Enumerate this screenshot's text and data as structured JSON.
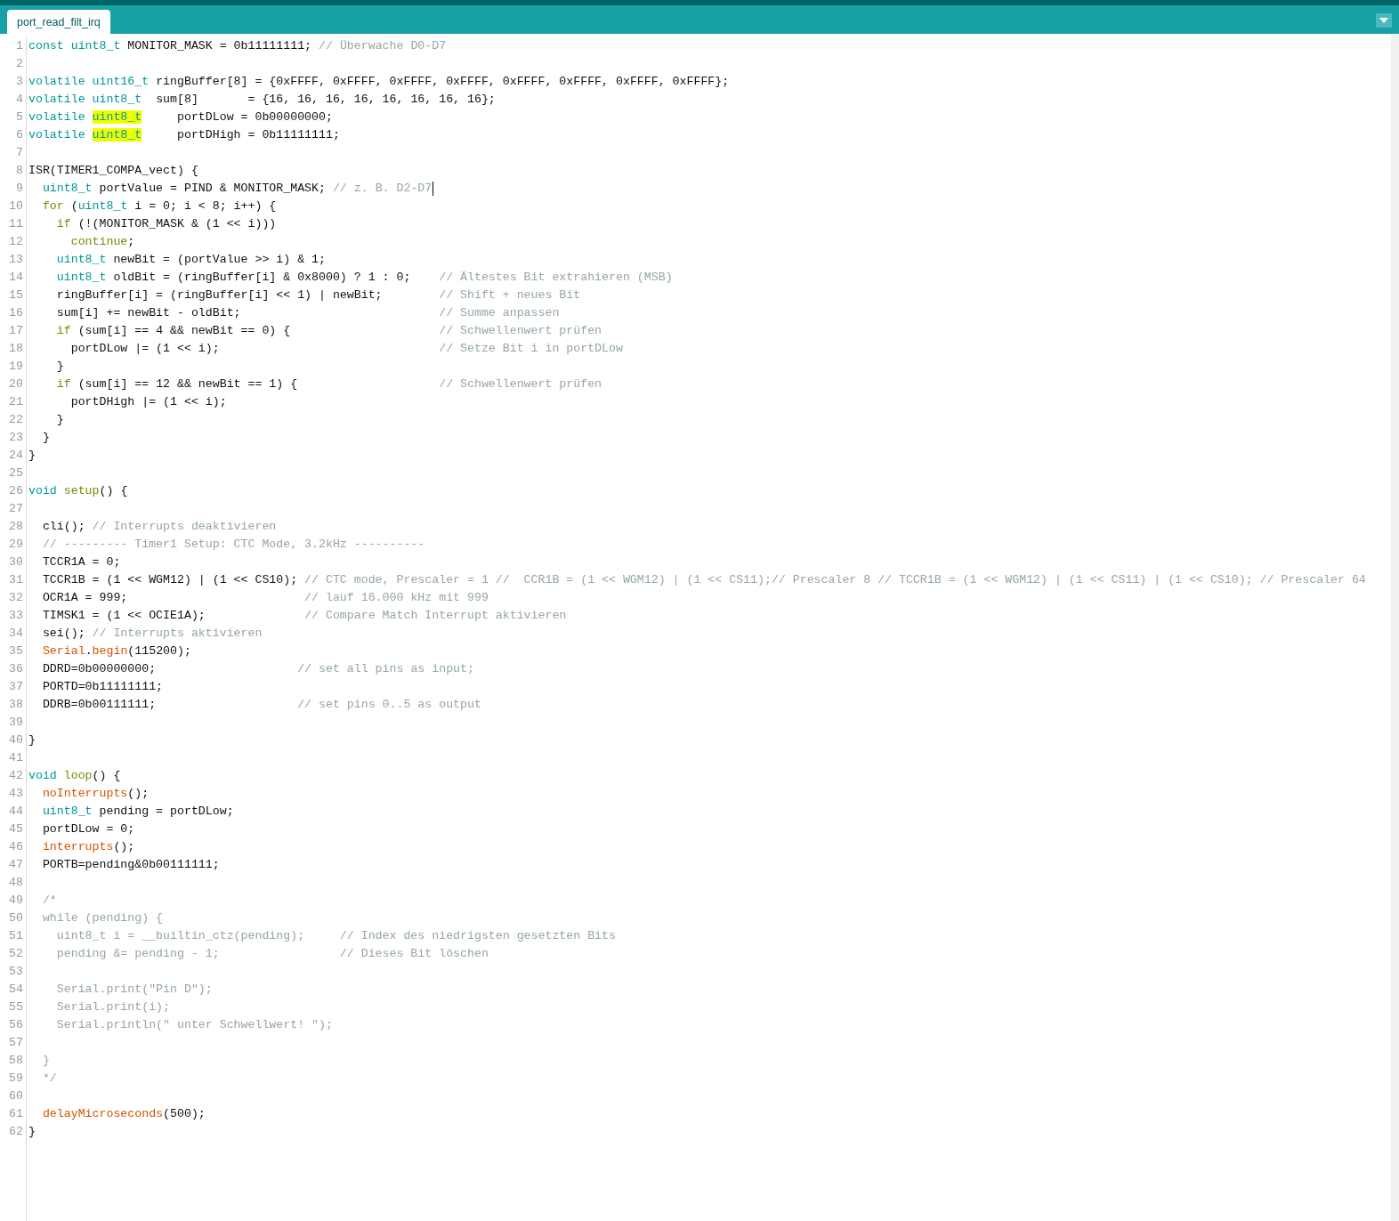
{
  "tabs": [
    {
      "label": "port_read_filt_irq",
      "selected": true
    }
  ],
  "editor": {
    "lines": [
      {
        "number": "1",
        "tokens": [
          {
            "kind": "type",
            "text": "const"
          },
          {
            "kind": "type",
            "text": " uint8_t"
          },
          {
            "kind": "plain",
            "text": " MONITOR_MASK = 0b11111111; "
          },
          {
            "kind": "comment",
            "text": "// Überwache D0-D7"
          }
        ]
      },
      {
        "number": "2"
      },
      {
        "number": "3",
        "tokens": [
          {
            "kind": "type",
            "text": "volatile uint16_t"
          },
          {
            "kind": "plain",
            "text": " ringBuffer[8] = {0xFFFF, 0xFFFF, 0xFFFF, 0xFFFF, 0xFFFF, 0xFFFF, 0xFFFF, 0xFFFF};"
          }
        ]
      },
      {
        "number": "4",
        "tokens": [
          {
            "kind": "type",
            "text": "volatile uint8_t"
          },
          {
            "kind": "plain",
            "text": "  sum[8]       = {16, 16, 16, 16, 16, 16, 16, 16};"
          }
        ]
      },
      {
        "number": "5",
        "tokens": [
          {
            "kind": "type",
            "text": "volatile "
          },
          {
            "kind": "type",
            "text": "uint8_t",
            "highlighted": true
          },
          {
            "kind": "plain",
            "text": "     portDLow = 0b00000000;"
          }
        ]
      },
      {
        "number": "6",
        "tokens": [
          {
            "kind": "type",
            "text": "volatile "
          },
          {
            "kind": "type",
            "text": "uint8_t",
            "highlighted": true
          },
          {
            "kind": "plain",
            "text": "     portDHigh = 0b11111111;"
          }
        ]
      },
      {
        "number": "7"
      },
      {
        "number": "8",
        "tokens": [
          {
            "kind": "plain",
            "text": "ISR(TIMER1_COMPA_vect) {"
          }
        ]
      },
      {
        "number": "9",
        "cursor": true,
        "tokens": [
          {
            "kind": "type",
            "text": "  uint8_t"
          },
          {
            "kind": "plain",
            "text": " portValue = PIND & MONITOR_MASK; "
          },
          {
            "kind": "comment",
            "text": "// z. B. D2-D7"
          }
        ]
      },
      {
        "number": "10",
        "tokens": [
          {
            "kind": "control",
            "text": "  for"
          },
          {
            "kind": "plain",
            "text": " ("
          },
          {
            "kind": "type",
            "text": "uint8_t"
          },
          {
            "kind": "plain",
            "text": " i = 0; i < 8; i++) {"
          }
        ]
      },
      {
        "number": "11",
        "tokens": [
          {
            "kind": "control",
            "text": "    if"
          },
          {
            "kind": "plain",
            "text": " (!(MONITOR_MASK & (1 << i)))"
          }
        ]
      },
      {
        "number": "12",
        "tokens": [
          {
            "kind": "control",
            "text": "      continue"
          },
          {
            "kind": "plain",
            "text": ";"
          }
        ]
      },
      {
        "number": "13",
        "tokens": [
          {
            "kind": "type",
            "text": "    uint8_t"
          },
          {
            "kind": "plain",
            "text": " newBit = (portValue >> i) & 1;"
          }
        ]
      },
      {
        "number": "14",
        "tokens": [
          {
            "kind": "type",
            "text": "    uint8_t"
          },
          {
            "kind": "plain",
            "text": " oldBit = (ringBuffer[i] & 0x8000) ? 1 : 0;    "
          },
          {
            "kind": "comment",
            "text": "// Ältestes Bit extrahieren (MSB)"
          }
        ]
      },
      {
        "number": "15",
        "tokens": [
          {
            "kind": "plain",
            "text": "    ringBuffer[i] = (ringBuffer[i] << 1) | newBit;        "
          },
          {
            "kind": "comment",
            "text": "// Shift + neues Bit"
          }
        ]
      },
      {
        "number": "16",
        "tokens": [
          {
            "kind": "plain",
            "text": "    sum[i] += newBit - oldBit;                            "
          },
          {
            "kind": "comment",
            "text": "// Summe anpassen"
          }
        ]
      },
      {
        "number": "17",
        "tokens": [
          {
            "kind": "control",
            "text": "    if"
          },
          {
            "kind": "plain",
            "text": " (sum[i] == 4 && newBit == 0) {                     "
          },
          {
            "kind": "comment",
            "text": "// Schwellenwert prüfen"
          }
        ]
      },
      {
        "number": "18",
        "tokens": [
          {
            "kind": "plain",
            "text": "      portDLow |= (1 << i);                               "
          },
          {
            "kind": "comment",
            "text": "// Setze Bit i in portDLow"
          }
        ]
      },
      {
        "number": "19",
        "tokens": [
          {
            "kind": "plain",
            "text": "    }"
          }
        ]
      },
      {
        "number": "20",
        "tokens": [
          {
            "kind": "control",
            "text": "    if"
          },
          {
            "kind": "plain",
            "text": " (sum[i] == 12 && newBit == 1) {                    "
          },
          {
            "kind": "comment",
            "text": "// Schwellenwert prüfen"
          }
        ]
      },
      {
        "number": "21",
        "tokens": [
          {
            "kind": "plain",
            "text": "      portDHigh |= (1 << i);"
          }
        ]
      },
      {
        "number": "22",
        "tokens": [
          {
            "kind": "plain",
            "text": "    }"
          }
        ]
      },
      {
        "number": "23",
        "tokens": [
          {
            "kind": "plain",
            "text": "  }"
          }
        ]
      },
      {
        "number": "24",
        "tokens": [
          {
            "kind": "plain",
            "text": "}"
          }
        ]
      },
      {
        "number": "25"
      },
      {
        "number": "26",
        "tokens": [
          {
            "kind": "type",
            "text": "void"
          },
          {
            "kind": "control",
            "text": " setup"
          },
          {
            "kind": "plain",
            "text": "() {"
          }
        ]
      },
      {
        "number": "27"
      },
      {
        "number": "28",
        "tokens": [
          {
            "kind": "plain",
            "text": "  cli(); "
          },
          {
            "kind": "comment",
            "text": "// Interrupts deaktivieren"
          }
        ]
      },
      {
        "number": "29",
        "tokens": [
          {
            "kind": "comment",
            "text": "  // --------- Timer1 Setup: CTC Mode, 3.2kHz ----------"
          }
        ]
      },
      {
        "number": "30",
        "tokens": [
          {
            "kind": "plain",
            "text": "  TCCR1A = 0;"
          }
        ]
      },
      {
        "number": "31",
        "tokens": [
          {
            "kind": "plain",
            "text": "  TCCR1B = (1 << WGM12) | (1 << CS10); "
          },
          {
            "kind": "comment",
            "text": "// CTC mode, Prescaler = 1 //  CCR1B = (1 << WGM12) | (1 << CS11);// Prescaler 8 // TCCR1B = (1 << WGM12) | (1 << CS11) | (1 << CS10); // Prescaler 64"
          }
        ]
      },
      {
        "number": "32",
        "tokens": [
          {
            "kind": "plain",
            "text": "  OCR1A = 999;                         "
          },
          {
            "kind": "comment",
            "text": "// lauf 16.000 kHz mit 999"
          }
        ]
      },
      {
        "number": "33",
        "tokens": [
          {
            "kind": "plain",
            "text": "  TIMSK1 = (1 << OCIE1A);              "
          },
          {
            "kind": "comment",
            "text": "// Compare Match Interrupt aktivieren"
          }
        ]
      },
      {
        "number": "34",
        "tokens": [
          {
            "kind": "plain",
            "text": "  sei(); "
          },
          {
            "kind": "comment",
            "text": "// Interrupts aktivieren"
          }
        ]
      },
      {
        "number": "35",
        "tokens": [
          {
            "kind": "function",
            "text": "  Serial"
          },
          {
            "kind": "plain",
            "text": "."
          },
          {
            "kind": "function",
            "text": "begin"
          },
          {
            "kind": "plain",
            "text": "(115200);"
          }
        ]
      },
      {
        "number": "36",
        "tokens": [
          {
            "kind": "plain",
            "text": "  DDRD=0b00000000;                    "
          },
          {
            "kind": "comment",
            "text": "// set all pins as input;"
          }
        ]
      },
      {
        "number": "37",
        "tokens": [
          {
            "kind": "plain",
            "text": "  PORTD=0b11111111;"
          }
        ]
      },
      {
        "number": "38",
        "tokens": [
          {
            "kind": "plain",
            "text": "  DDRB=0b00111111;                    "
          },
          {
            "kind": "comment",
            "text": "// set pins 0..5 as output"
          }
        ]
      },
      {
        "number": "39"
      },
      {
        "number": "40",
        "tokens": [
          {
            "kind": "plain",
            "text": "}"
          }
        ]
      },
      {
        "number": "41"
      },
      {
        "number": "42",
        "tokens": [
          {
            "kind": "type",
            "text": "void"
          },
          {
            "kind": "control",
            "text": " loop"
          },
          {
            "kind": "plain",
            "text": "() {"
          }
        ]
      },
      {
        "number": "43",
        "tokens": [
          {
            "kind": "function",
            "text": "  noInterrupts"
          },
          {
            "kind": "plain",
            "text": "();"
          }
        ]
      },
      {
        "number": "44",
        "tokens": [
          {
            "kind": "type",
            "text": "  uint8_t"
          },
          {
            "kind": "plain",
            "text": " pending = portDLow;"
          }
        ]
      },
      {
        "number": "45",
        "tokens": [
          {
            "kind": "plain",
            "text": "  portDLow = 0;"
          }
        ]
      },
      {
        "number": "46",
        "tokens": [
          {
            "kind": "function",
            "text": "  interrupts"
          },
          {
            "kind": "plain",
            "text": "();"
          }
        ]
      },
      {
        "number": "47",
        "tokens": [
          {
            "kind": "plain",
            "text": "  PORTB=pending&0b00111111;"
          }
        ]
      },
      {
        "number": "48"
      },
      {
        "number": "49",
        "tokens": [
          {
            "kind": "comment",
            "text": "  /*"
          }
        ]
      },
      {
        "number": "50",
        "tokens": [
          {
            "kind": "comment",
            "text": "  while (pending) {"
          }
        ]
      },
      {
        "number": "51",
        "tokens": [
          {
            "kind": "comment",
            "text": "    uint8_t i = __builtin_ctz(pending);     // Index des niedrigsten gesetzten Bits"
          }
        ]
      },
      {
        "number": "52",
        "tokens": [
          {
            "kind": "comment",
            "text": "    pending &= pending - 1;                 // Dieses Bit löschen"
          }
        ]
      },
      {
        "number": "53"
      },
      {
        "number": "54",
        "tokens": [
          {
            "kind": "comment",
            "text": "    Serial.print(\"Pin D\");"
          }
        ]
      },
      {
        "number": "55",
        "tokens": [
          {
            "kind": "comment",
            "text": "    Serial.print(i);"
          }
        ]
      },
      {
        "number": "56",
        "tokens": [
          {
            "kind": "comment",
            "text": "    Serial.println(\" unter Schwellwert! \");"
          }
        ]
      },
      {
        "number": "57"
      },
      {
        "number": "58",
        "tokens": [
          {
            "kind": "comment",
            "text": "  }"
          }
        ]
      },
      {
        "number": "59",
        "tokens": [
          {
            "kind": "comment",
            "text": "  */"
          }
        ]
      },
      {
        "number": "60"
      },
      {
        "number": "61",
        "tokens": [
          {
            "kind": "function",
            "text": "  delayMicroseconds"
          },
          {
            "kind": "plain",
            "text": "(500);"
          }
        ]
      },
      {
        "number": "62",
        "tokens": [
          {
            "kind": "plain",
            "text": "}"
          }
        ]
      }
    ]
  }
}
